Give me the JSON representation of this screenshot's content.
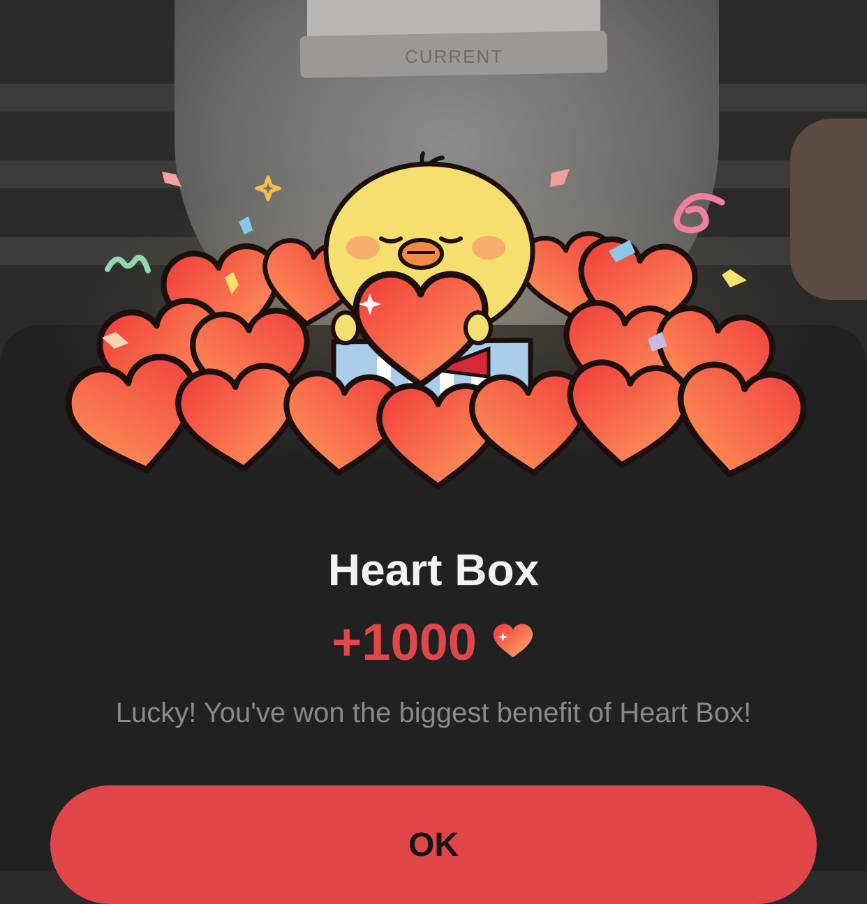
{
  "dialog": {
    "title": "Heart Box",
    "reward_amount": "+1000",
    "reward_icon": "heart-icon",
    "message": "Lucky! You've won the biggest benefit of Heart Box!",
    "ok_label": "OK"
  },
  "background": {
    "waistband_text": "CURRENT"
  },
  "colors": {
    "accent": "#e04549",
    "sheet": "#212121",
    "heart_light": "#ff9a5a",
    "heart_dark": "#ee3e3e",
    "chick": "#f6df6e"
  }
}
